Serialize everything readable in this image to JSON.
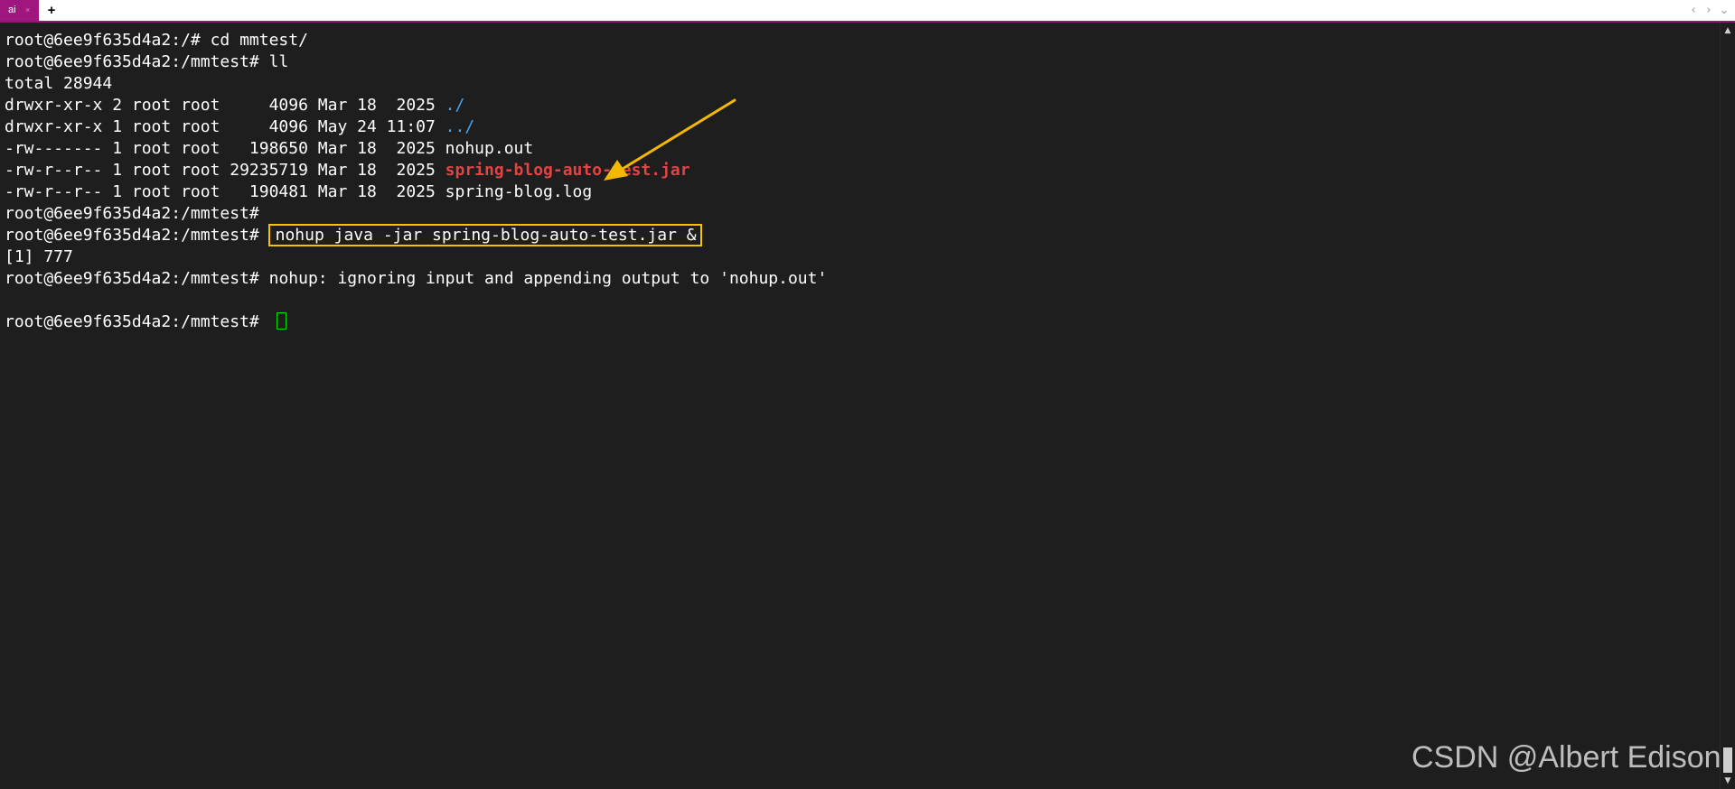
{
  "tabbar": {
    "tab_label": "ai",
    "tab_close": "×",
    "new_tab": "+",
    "nav_prev": "‹",
    "nav_next": "›",
    "menu": "⌄"
  },
  "terminal": {
    "prompt_root": "root@6ee9f635d4a2:/# ",
    "prompt_mmtest": "root@6ee9f635d4a2:/mmtest# ",
    "cmd_cd": "cd mmtest/",
    "cmd_ll": "ll",
    "total": "total 28944",
    "listing": [
      {
        "meta": "drwxr-xr-x 2 root root     4096 Mar 18  2025 ",
        "name": "./"
      },
      {
        "meta": "drwxr-xr-x 1 root root     4096 May 24 11:07 ",
        "name": "../"
      },
      {
        "meta": "-rw------- 1 root root   198650 Mar 18  2025 ",
        "name": "nohup.out"
      },
      {
        "meta": "-rw-r--r-- 1 root root 29235719 Mar 18  2025 ",
        "name": "spring-blog-auto-test.jar"
      },
      {
        "meta": "-rw-r--r-- 1 root root   190481 Mar 18  2025 ",
        "name": "spring-blog.log"
      }
    ],
    "cmd_nohup": "nohup java -jar spring-blog-auto-test.jar &",
    "job": "[1] 777",
    "nohup_output": "nohup: ignoring input and appending output to 'nohup.out'"
  },
  "watermark": "CSDN @Albert Edison",
  "colors": {
    "background": "#1e1e1e",
    "text": "#ffffff",
    "directory": "#4aa3e8",
    "archive": "#e04444",
    "highlight_box": "#f5c400",
    "arrow": "#f5b800",
    "cursor": "#00e000",
    "tab_accent": "#a0167f"
  }
}
